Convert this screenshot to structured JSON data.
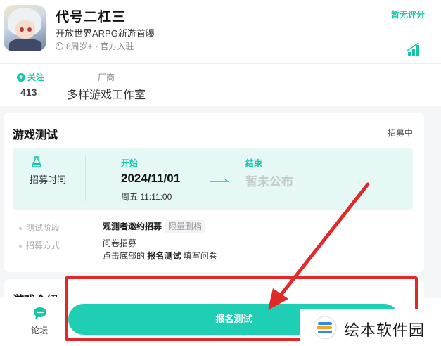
{
  "header": {
    "title": "代号二杠三",
    "slogan": "开放世界ARPG新游首曝",
    "meta": "8周岁+ · 官方入驻",
    "rating": "暂无评分"
  },
  "stats": {
    "follow_label": "关注",
    "follow_count": "413",
    "vendor_label": "厂商",
    "vendor_name": "多样游戏工作室"
  },
  "test_card": {
    "title": "游戏测试",
    "status": "招募中",
    "recruit_time_label": "招募时间",
    "start_label": "开始",
    "start_date": "2024/11/01",
    "start_time": "周五 11:11:00",
    "end_label": "结束",
    "end_value": "暂未公布",
    "stage_label": "测试阶段",
    "stage_value": "观测者邀约招募",
    "stage_tag": "限量删档",
    "method_label": "招募方式",
    "method_line1": "问卷招募",
    "method_line2_prefix": "点击底部的",
    "method_line2_bold": "报名测试",
    "method_line2_suffix": "填写问卷"
  },
  "next_card": {
    "title": "游戏介绍"
  },
  "bottom_bar": {
    "forum_label": "论坛",
    "signup_label": "报名测试"
  },
  "watermark": {
    "text": "绘本软件园"
  },
  "colors": {
    "accent": "#1fcfb3",
    "annotation": "#e02a2a"
  }
}
